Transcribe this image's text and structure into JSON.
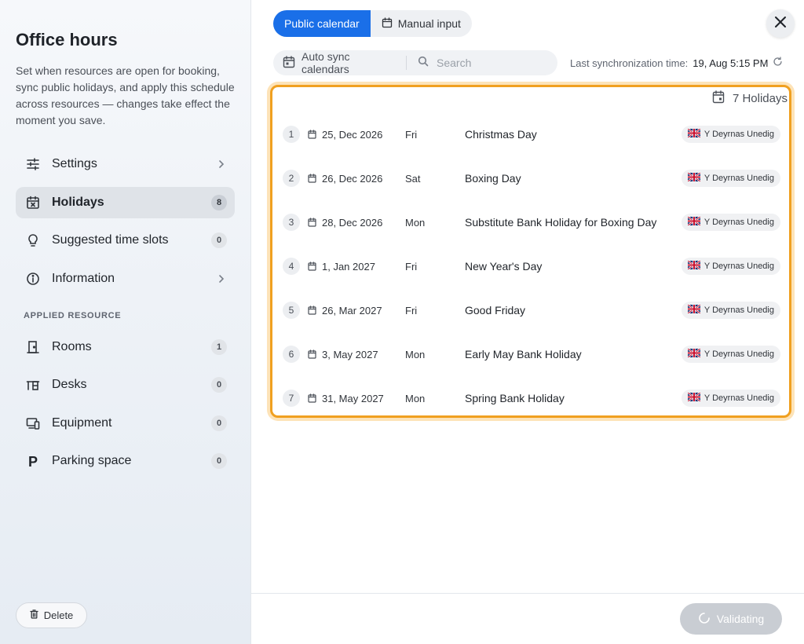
{
  "panel": {
    "title": "Office hours",
    "description": "Set when resources are open for booking, sync public holidays, and apply this schedule across resources — changes take effect the moment you save."
  },
  "nav": {
    "settings": {
      "label": "Settings"
    },
    "holidays": {
      "label": "Holidays",
      "count": "8"
    },
    "suggested": {
      "label": "Suggested time slots",
      "count": "0"
    },
    "information": {
      "label": "Information"
    }
  },
  "applied": {
    "heading": "APPLIED RESOURCE",
    "rooms": {
      "label": "Rooms",
      "count": "1"
    },
    "desks": {
      "label": "Desks",
      "count": "0"
    },
    "equipment": {
      "label": "Equipment",
      "count": "0"
    },
    "parking": {
      "label": "Parking space",
      "count": "0"
    }
  },
  "actions": {
    "delete": "Delete",
    "validating": "Validating"
  },
  "tabs": {
    "public": "Public calendar",
    "manual": "Manual input"
  },
  "toolbar": {
    "sync_label": "Auto sync calendars",
    "search_placeholder": "Search",
    "last_sync_label": "Last synchronization time:",
    "last_sync_value": "19, Aug 5:15 PM"
  },
  "holidays": {
    "count_label": "7 Holidays",
    "region": "Y Deyrnas Unedig",
    "rows": [
      {
        "num": "1",
        "date": "25, Dec 2026",
        "day": "Fri",
        "name": "Christmas Day"
      },
      {
        "num": "2",
        "date": "26, Dec 2026",
        "day": "Sat",
        "name": "Boxing Day"
      },
      {
        "num": "3",
        "date": "28, Dec 2026",
        "day": "Mon",
        "name": "Substitute Bank Holiday for Boxing Day"
      },
      {
        "num": "4",
        "date": "1, Jan 2027",
        "day": "Fri",
        "name": "New Year's Day"
      },
      {
        "num": "5",
        "date": "26, Mar 2027",
        "day": "Fri",
        "name": "Good Friday"
      },
      {
        "num": "6",
        "date": "3, May 2027",
        "day": "Mon",
        "name": "Early May Bank Holiday"
      },
      {
        "num": "7",
        "date": "31, May 2027",
        "day": "Mon",
        "name": "Spring Bank Holiday"
      }
    ]
  },
  "colors": {
    "accent": "#1a6fe8",
    "highlight": "#f0a020",
    "disabled": "#c9cdd3"
  },
  "icons": {
    "settings": "sliders-icon",
    "holidays": "calendar-x-icon",
    "suggested": "lightbulb-icon",
    "information": "info-icon",
    "rooms": "door-icon",
    "desks": "desk-icon",
    "equipment": "devices-icon",
    "parking": "parking-icon",
    "flag": "uk-flag-icon"
  }
}
